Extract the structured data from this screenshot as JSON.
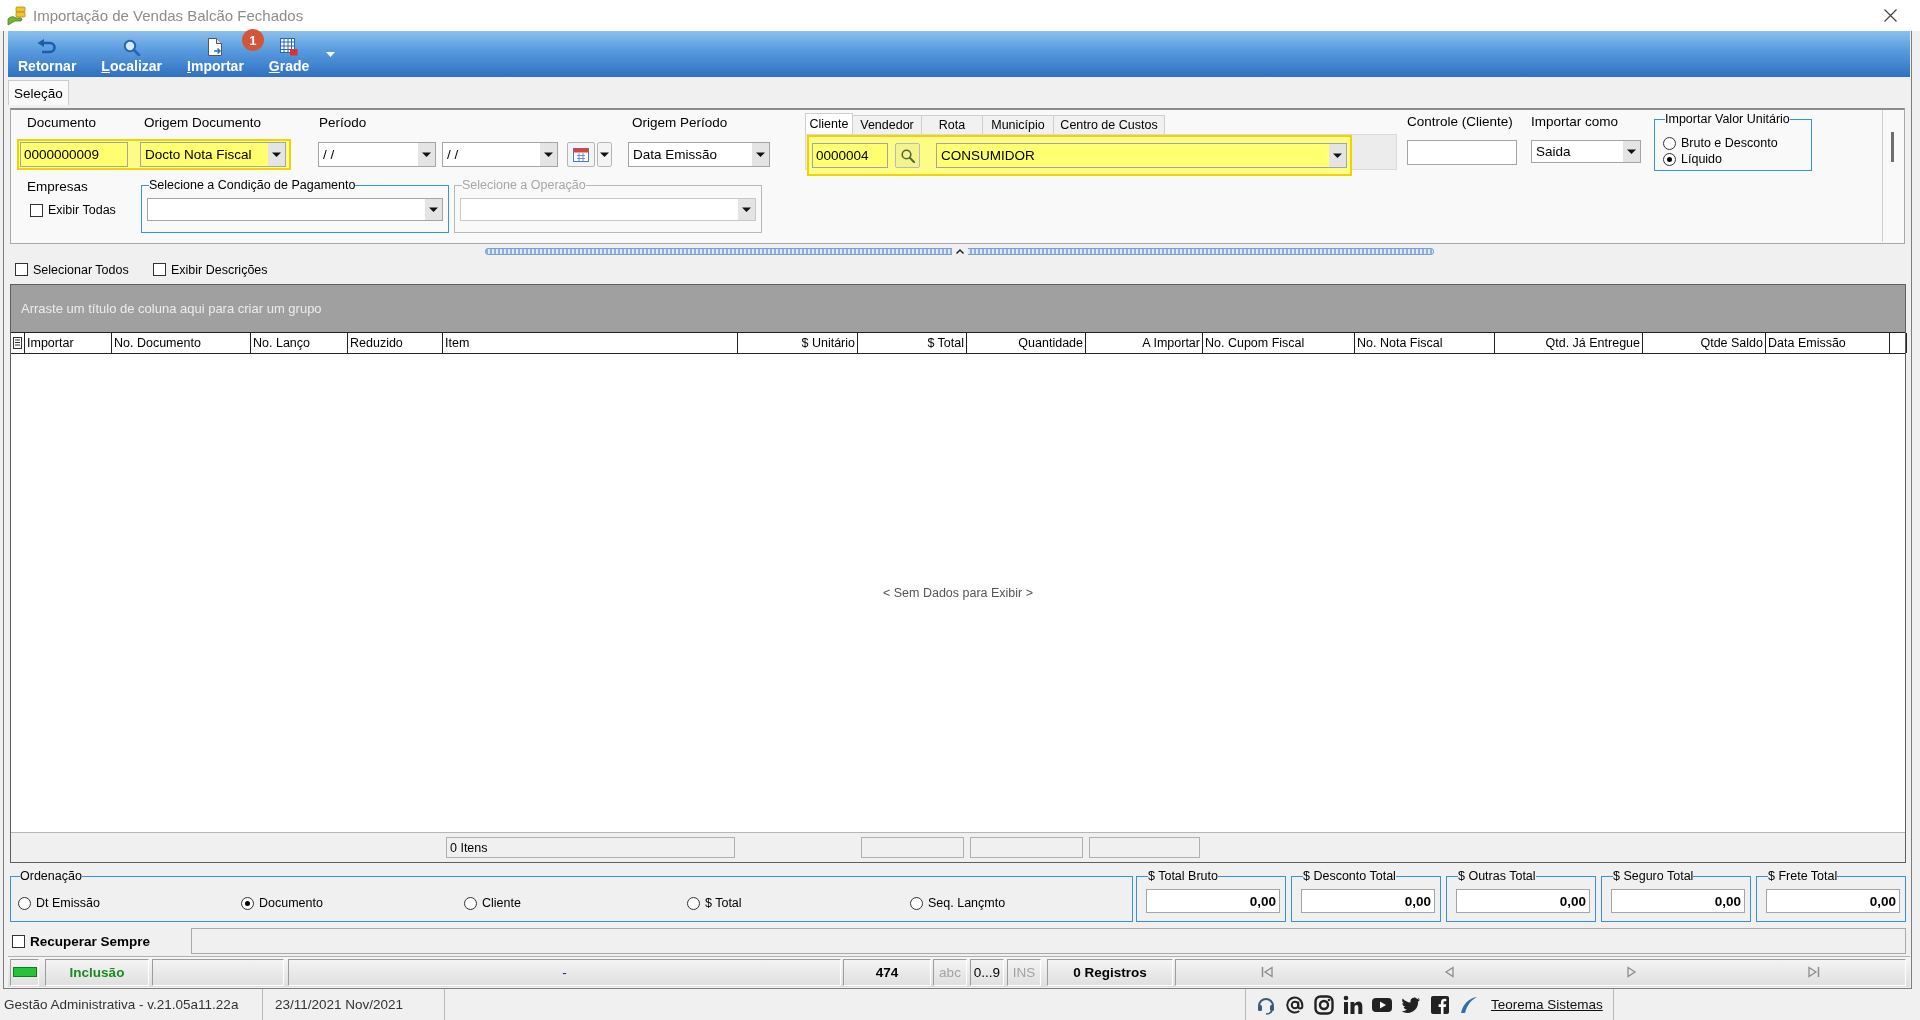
{
  "window": {
    "title": "Importação de Vendas Balcão Fechados"
  },
  "toolbar": {
    "buttons": [
      {
        "kind": "back",
        "label": "Retornar",
        "mnemonic": false,
        "menu": false
      },
      {
        "kind": "search",
        "label": "Localizar",
        "mnemonic": true,
        "menu": false
      },
      {
        "kind": "import",
        "label": "Importar",
        "mnemonic": true,
        "menu": false,
        "badge": "1"
      },
      {
        "kind": "grid",
        "label": "Grade",
        "mnemonic": true,
        "menu": true
      }
    ]
  },
  "tabs": [
    {
      "label": "Seleção",
      "selected": true
    }
  ],
  "selection": {
    "document_group": {
      "highlighted": true,
      "fields": [
        {
          "kind": "text",
          "label": "Documento",
          "value": "0000000009"
        },
        {
          "kind": "combo",
          "label": "Origem Documento",
          "value": "Docto Nota Fiscal"
        }
      ]
    },
    "periodo": {
      "label": "Período",
      "from": "/ /",
      "to": "/ /"
    },
    "origem_periodo": {
      "label": "Origem Período",
      "value": "Data Emissão"
    },
    "filter_tabs": [
      {
        "label": "Cliente",
        "selected": true
      },
      {
        "label": "Vendedor",
        "selected": false
      },
      {
        "label": "Rota",
        "selected": false
      },
      {
        "label": "Município",
        "selected": false
      },
      {
        "label": "Centro de Custos",
        "selected": false
      }
    ],
    "cliente": {
      "highlighted": true,
      "code": "0000004",
      "name": "CONSUMIDOR"
    },
    "controle": {
      "label": "Controle (Cliente)"
    },
    "importar_como": {
      "label": "Importar como",
      "value": "Saida"
    },
    "valor_unitario": {
      "title": "Importar Valor Unitário",
      "options": [
        {
          "label": "Bruto e Desconto",
          "selected": false
        },
        {
          "label": "Líquido",
          "selected": true
        }
      ]
    },
    "empresas": {
      "label": "Empresas",
      "option": {
        "label": "Exibir Todas",
        "checked": false
      }
    },
    "condicao_pagamento": {
      "title": "Selecione a Condição de Pagamento",
      "disabled": false
    },
    "operacao": {
      "title": "Selecione a Operação",
      "disabled": true
    }
  },
  "grid_options": [
    {
      "label": "Selecionar Todos",
      "checked": false
    },
    {
      "label": "Exibir Descrições",
      "checked": false
    }
  ],
  "table": {
    "group_hint": "Arraste um título de coluna aqui para criar um grupo",
    "columns": [
      {
        "label": "Importar",
        "right_aligned": false
      },
      {
        "label": "No. Documento",
        "right_aligned": false
      },
      {
        "label": "No. Lanço",
        "right_aligned": false
      },
      {
        "label": "Reduzido",
        "right_aligned": false
      },
      {
        "label": "Item",
        "right_aligned": false
      },
      {
        "label": "$ Unitário",
        "right_aligned": true
      },
      {
        "label": "$ Total",
        "right_aligned": true
      },
      {
        "label": "Quantidade",
        "right_aligned": true
      },
      {
        "label": "A Importar",
        "right_aligned": true
      },
      {
        "label": "No. Cupom Fiscal",
        "right_aligned": false
      },
      {
        "label": "No. Nota Fiscal",
        "right_aligned": false
      },
      {
        "label": "Qtd. Já Entregue",
        "right_aligned": true
      },
      {
        "label": "Qtde Saldo",
        "right_aligned": true
      },
      {
        "label": "Data Emissão",
        "right_aligned": false
      }
    ],
    "empty_text": "< Sem Dados para Exibir >",
    "items_count": "0 Itens"
  },
  "ordenacao": {
    "title": "Ordenação",
    "options": [
      {
        "label": "Dt Emissão",
        "selected": false
      },
      {
        "label": "Documento",
        "selected": true
      },
      {
        "label": "Cliente",
        "selected": false
      },
      {
        "label": "$ Total",
        "selected": false
      },
      {
        "label": "Seq. Lançmto",
        "selected": false
      }
    ]
  },
  "totals": [
    {
      "label": "$ Total Bruto",
      "value": "0,00"
    },
    {
      "label": "$ Desconto Total",
      "value": "0,00"
    },
    {
      "label": "$ Outras Total",
      "value": "0,00"
    },
    {
      "label": "$ Seguro Total",
      "value": "0,00"
    },
    {
      "label": "$ Frete Total",
      "value": "0,00"
    }
  ],
  "recuperar_sempre": {
    "label": "Recuperar Sempre",
    "checked": false
  },
  "status_bar": {
    "mode": "Inclusão",
    "message": "-",
    "number": "474",
    "indicators": [
      {
        "label": "abc",
        "active": false
      },
      {
        "label": "0...9",
        "active": true
      },
      {
        "label": "INS",
        "active": false
      }
    ],
    "records": "0 Registros"
  },
  "app_bar": {
    "version": "Gestão Administrativa - v.21.05a11.22a",
    "date": "23/11/2021 Nov/2021",
    "link": "Teorema Sistemas"
  }
}
